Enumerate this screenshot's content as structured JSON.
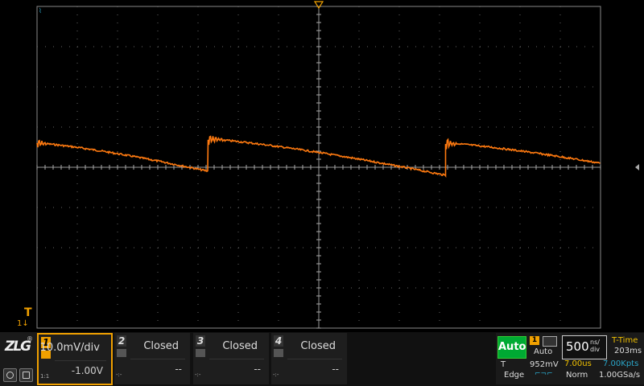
{
  "colors": {
    "trace_ch1": "#ff7a10",
    "ch1_accent": "#f0a000",
    "grid": "#7a7a7a",
    "auto_status": "#00aa33",
    "cyan_text": "#2aa5c8",
    "yellow_text": "#f0c000"
  },
  "brand": {
    "logo_text": "ZLG",
    "registered": "®"
  },
  "trigger_marker": {
    "label": "T",
    "sub": "1↓"
  },
  "channels": [
    {
      "num": "1",
      "label": "10.0mV/div",
      "value": "-1.00V",
      "small": "1:1",
      "state": "active"
    },
    {
      "num": "2",
      "label": "Closed",
      "value": "--",
      "small": "-:-",
      "state": "closed"
    },
    {
      "num": "3",
      "label": "Closed",
      "value": "--",
      "small": "-:-",
      "state": "closed"
    },
    {
      "num": "4",
      "label": "Closed",
      "value": "--",
      "small": "-:-",
      "state": "closed"
    }
  ],
  "status": {
    "run_mode": "Auto",
    "trigger_channel": "1",
    "trigger_mode_label": "Auto",
    "trigger_level_prefix": "T",
    "trigger_level": "952mV",
    "trigger_type": "Edge",
    "timebase_value": "500",
    "timebase_unit_top": "ns/",
    "timebase_unit_bottom": "div",
    "time_label": "T-Time",
    "time_value": "203ms",
    "delay": "7.00us",
    "memory_depth": "7.00Kpts",
    "acq_mode": "Norm",
    "sample_rate": "1.00GSa/s"
  },
  "trace": {
    "channel": "1",
    "segments": [
      {
        "period_start_div": -7.0,
        "period_end_div": -2.75,
        "start_level_div": 0.6,
        "end_level_div": -0.1
      },
      {
        "period_start_div": -2.75,
        "period_end_div": 3.15,
        "start_level_div": 0.7,
        "end_level_div": -0.2
      },
      {
        "period_start_div": 3.15,
        "period_end_div": 7.0,
        "start_level_div": 0.6,
        "end_level_div": 0.1
      }
    ]
  }
}
